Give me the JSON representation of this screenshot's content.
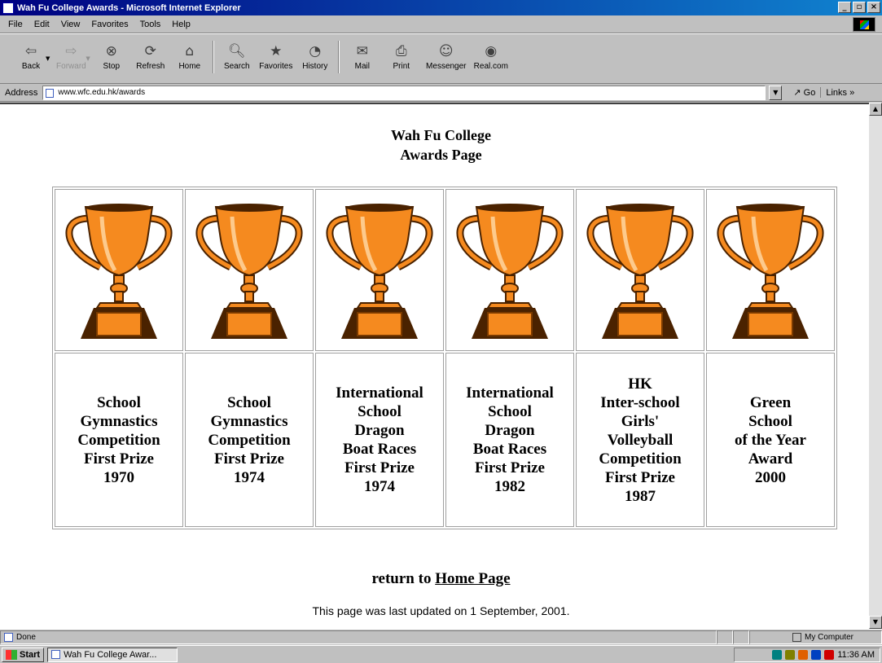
{
  "window": {
    "title": "Wah Fu College Awards - Microsoft Internet Explorer",
    "minimize": "_",
    "maximize": "▫",
    "close": "×"
  },
  "menu": [
    "File",
    "Edit",
    "View",
    "Favorites",
    "Tools",
    "Help"
  ],
  "toolbar": {
    "back": "Back",
    "forward": "Forward",
    "stop": "Stop",
    "refresh": "Refresh",
    "home": "Home",
    "search": "Search",
    "favorites": "Favorites",
    "history": "History",
    "mail": "Mail",
    "print": "Print",
    "messenger": "Messenger",
    "realcom": "Real.com"
  },
  "address": {
    "label": "Address",
    "url": "www.wfc.edu.hk/awards",
    "go": "Go",
    "links": "Links »"
  },
  "page": {
    "heading_line1": "Wah Fu College",
    "heading_line2": "Awards Page",
    "awards": [
      {
        "lines": [
          "School",
          "Gymnastics",
          "Competition",
          "First Prize",
          "1970"
        ]
      },
      {
        "lines": [
          "School",
          "Gymnastics",
          "Competition",
          "First Prize",
          "1974"
        ]
      },
      {
        "lines": [
          "International",
          "School",
          "Dragon",
          "Boat Races",
          "First Prize",
          "1974"
        ]
      },
      {
        "lines": [
          "International",
          "School",
          "Dragon",
          "Boat Races",
          "First Prize",
          "1982"
        ]
      },
      {
        "lines": [
          "HK",
          "Inter-school",
          "Girls'",
          "Volleyball",
          "Competition",
          "First Prize",
          "1987"
        ]
      },
      {
        "lines": [
          "Green",
          "School",
          "of the Year",
          "Award",
          "2000"
        ]
      }
    ],
    "return_prefix": "return to ",
    "return_link": "Home Page",
    "updated": "This page was last updated on 1 September, 2001."
  },
  "status": {
    "text": "Done",
    "zone": "My Computer"
  },
  "taskbar": {
    "start": "Start",
    "task": "Wah Fu College Awar...",
    "clock": "11:36 AM"
  },
  "colors": {
    "trophy_gold": "#f58a1f",
    "trophy_dark": "#4a2200",
    "titlebar": "#000080"
  }
}
